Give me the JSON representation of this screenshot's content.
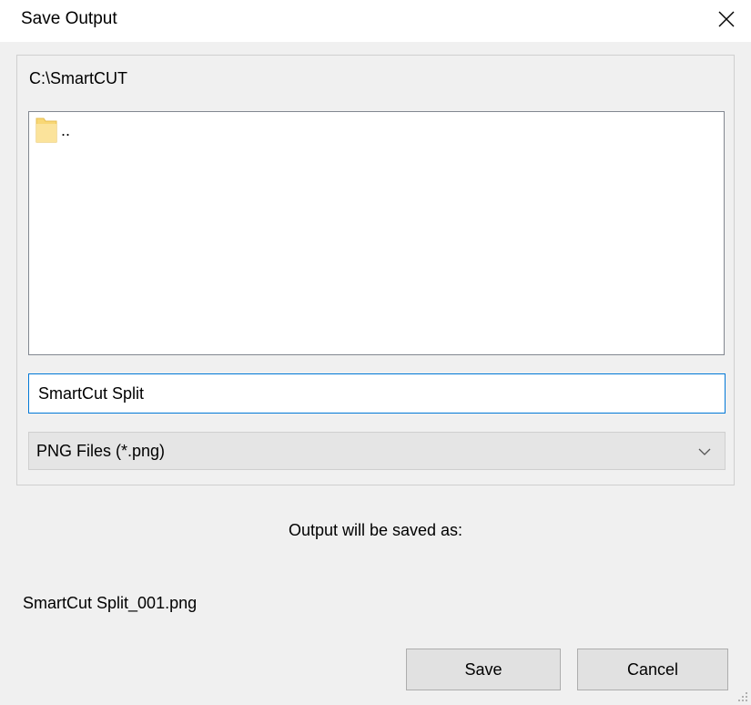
{
  "window": {
    "title": "Save Output",
    "close_icon": "close-icon"
  },
  "browser": {
    "current_path": "C:\\SmartCUT",
    "items": [
      {
        "name": "..",
        "icon": "folder-icon"
      }
    ]
  },
  "file_name": {
    "value": "SmartCut Split"
  },
  "file_type": {
    "selected": "PNG Files (*.png)",
    "icon": "chevron-down-icon"
  },
  "output": {
    "label": "Output will be saved as:",
    "filename": "SmartCut Split_001.png"
  },
  "buttons": {
    "save_label": "Save",
    "cancel_label": "Cancel"
  },
  "colors": {
    "background": "#f0f0f0",
    "focus_border": "#0078d7",
    "button_face": "#e1e1e1"
  }
}
